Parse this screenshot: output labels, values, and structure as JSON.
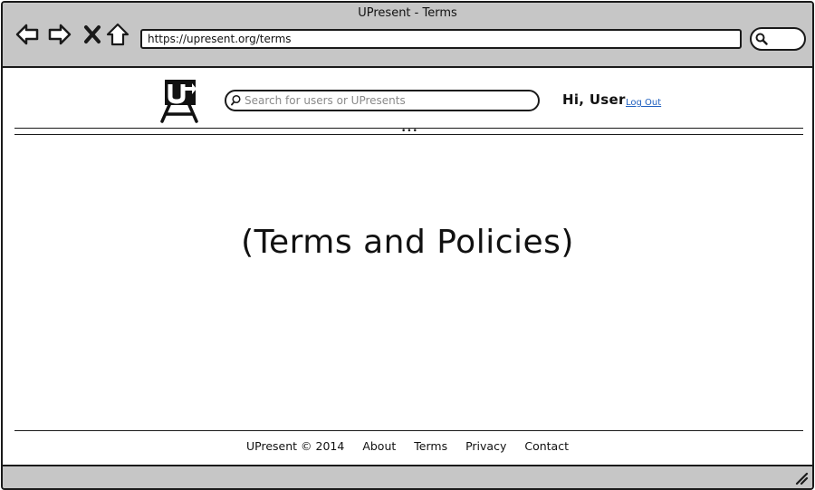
{
  "window": {
    "title": "UPresent - Terms"
  },
  "browser": {
    "url": "https://upresent.org/terms",
    "icons": [
      "back-icon",
      "forward-icon",
      "stop-icon",
      "home-icon",
      "search-icon"
    ]
  },
  "header": {
    "logo_icon": "upresent-easel-logo",
    "search_placeholder": "Search for users or UPresents",
    "greeting": "Hi, User",
    "logout_label": "Log Out"
  },
  "main": {
    "heading": "(Terms and Policies)"
  },
  "footer": {
    "copyright": "UPresent © 2014",
    "links": [
      "About",
      "Terms",
      "Privacy",
      "Contact"
    ]
  },
  "colors": {
    "chrome": "#c6c6c6",
    "link": "#1f5fbf",
    "border": "#1a1a1a"
  }
}
